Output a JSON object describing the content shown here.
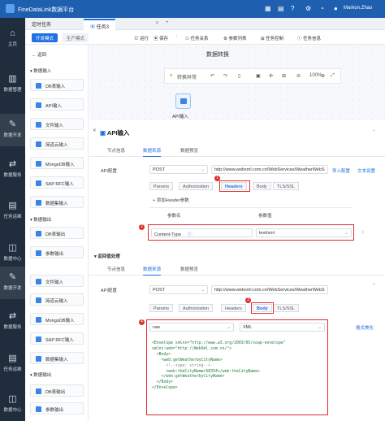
{
  "app": {
    "name": "FineDataLink数据平台",
    "user": "Markon.Zhao"
  },
  "leftnav": [
    {
      "icon": "home-icon",
      "glyph": "⌂",
      "label": "主页"
    },
    {
      "icon": "data-manage-icon",
      "glyph": "▥",
      "label": "数据管理"
    },
    {
      "icon": "data-dev-icon",
      "glyph": "✎",
      "label": "数据开发"
    },
    {
      "icon": "data-service-icon",
      "glyph": "⇄",
      "label": "数据服务"
    },
    {
      "icon": "task-ops-icon",
      "glyph": "▤",
      "label": "任务运维"
    },
    {
      "icon": "data-center-icon",
      "glyph": "◫",
      "label": "数据中心"
    },
    {
      "icon": "data-dev-icon",
      "glyph": "✎",
      "label": "数据开发"
    },
    {
      "icon": "data-service-icon",
      "glyph": "⇄",
      "label": "数据服务"
    },
    {
      "icon": "task-ops-icon",
      "glyph": "▤",
      "label": "任务运维"
    },
    {
      "icon": "data-center-icon",
      "glyph": "◫",
      "label": "数据中心"
    }
  ],
  "tabs": {
    "scheduled": "定时任务",
    "task": "任务3"
  },
  "modes": {
    "dev": "开发模式",
    "prod": "生产模式"
  },
  "actions": {
    "run": "运行",
    "save": "保存",
    "relation": "任务关系",
    "params": "参数列表",
    "control": "任务控制",
    "info": "任务信息"
  },
  "side": {
    "back": "返回",
    "g1": "数据输入",
    "g1_items": [
      "DB表输入",
      "API输入",
      "文件输入",
      "简道云输入",
      "MongoDB输入",
      "SAP RFC输入",
      "数据集输入"
    ],
    "g2": "数据输出",
    "g2_items": [
      "DB表输出",
      "参数输出"
    ],
    "g1b_items": [
      "文件输入",
      "简道云输入",
      "MongoDB输入",
      "SAP RFC输入",
      "数据集输入"
    ],
    "g2b": "数据输出",
    "g2b_items": [
      "DB表输出",
      "参数输出"
    ]
  },
  "canvas": {
    "title": "数据转换",
    "abnormal": "转换异常",
    "zoom": "100%",
    "node_label": "API输入"
  },
  "panel1": {
    "title": "API输入",
    "tabs": [
      "节点信息",
      "数据来源",
      "数据预览"
    ],
    "api_config": "API配置",
    "method": "POST",
    "url": "http://www.webxml.com.cn/WebServices/WeatherWebS",
    "import_link": "导入配置",
    "text_link": "文本设置",
    "subtabs": [
      "Params",
      "Authorization",
      "Headers",
      "Body",
      "TLS/SSL"
    ],
    "add_header": "+ 添加Header参数",
    "col_name": "参数名",
    "col_value": "参数值",
    "param_name": "Content-Type",
    "param_value": "text/xml"
  },
  "panel2": {
    "section": "返回值处理",
    "tabs": [
      "节点信息",
      "数据来源",
      "数据预览"
    ],
    "api_config": "API配置",
    "method": "POST",
    "url": "http://www.webxml.com.cn/WebServices/WeatherWebS",
    "subtabs": [
      "Params",
      "Authorization",
      "Headers",
      "Body",
      "TLS/SSL"
    ],
    "body_type": "raw",
    "format": "XML",
    "beautify": "格式美化",
    "code": [
      "<Envelope xmlns=\"http://www.w3.org/2003/05/soap-envelope\"",
      "xmlns:web=\"http://WebXml.com.cn/\">",
      "  <Body>",
      "    <web:getWeatherbyCityName>",
      "      <!--type: string-->",
      "      <web:theCityName>58354</web:theCityName>",
      "    </web:getWeatherbyCityName>",
      "  </Body>",
      "</Envelope>"
    ]
  },
  "badges": [
    "1",
    "2",
    "3",
    "4"
  ],
  "colors": {
    "brand": "#1f5fb0",
    "accent": "#1f6fe5",
    "highlight": "#e02d2d"
  }
}
